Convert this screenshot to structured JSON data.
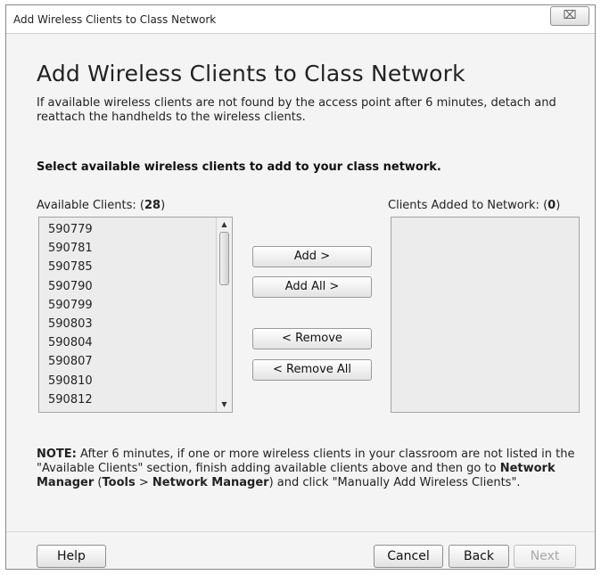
{
  "window": {
    "title": "Add Wireless Clients to Class Network",
    "close_glyph": "⌧"
  },
  "main": {
    "heading": "Add Wireless Clients to Class Network",
    "intro": "If available wireless clients are not found by the access point after 6 minutes, detach and reattach the handhelds to the wireless clients.",
    "instruction": "Select available wireless clients to add to your class network."
  },
  "available": {
    "label": "Available Clients: (",
    "count": "28",
    "label_end": ")",
    "items": [
      "590779",
      "590781",
      "590785",
      "590790",
      "590799",
      "590803",
      "590804",
      "590807",
      "590810",
      "590812"
    ],
    "scroll_up_icon": "▲",
    "scroll_down_icon": "▼"
  },
  "added": {
    "label": "Clients Added to Network: (",
    "count": "0",
    "label_end": ")"
  },
  "actions": {
    "add": "Add >",
    "add_all": "Add All >",
    "remove": "< Remove",
    "remove_all": "< Remove All"
  },
  "note": {
    "prefix": "NOTE:",
    "text1": " After 6 minutes, if one or more wireless clients in your classroom are not listed in the \"Available Clients\" section, finish adding available clients above and then go to ",
    "nm_bold": "Network Manager",
    "paren_open": " (",
    "tools_bold": "Tools",
    "gt": " > ",
    "nm_bold2": "Network Manager",
    "text2": ") and click \"Manually Add Wireless Clients\"."
  },
  "footer": {
    "help": "Help",
    "cancel": "Cancel",
    "back": "Back",
    "next": "Next"
  }
}
